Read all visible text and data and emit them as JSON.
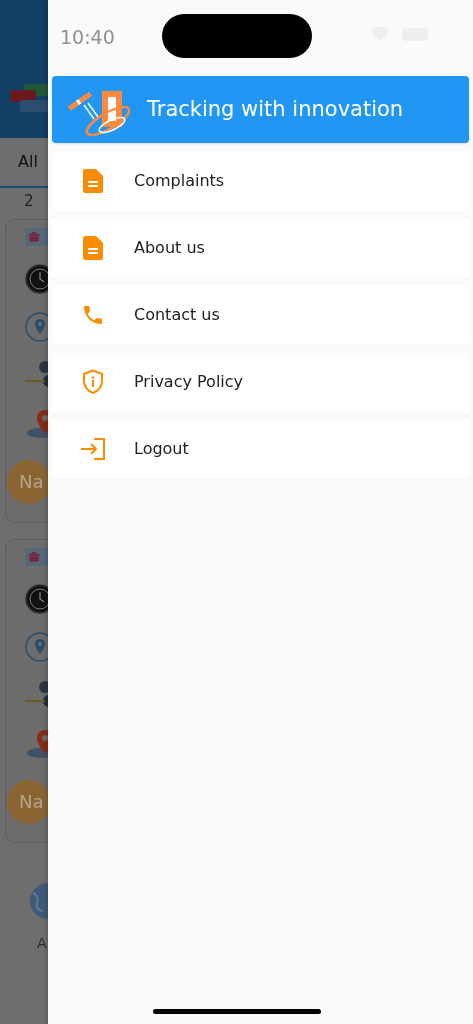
{
  "status_bar": {
    "time": "10:40"
  },
  "background": {
    "tab": "All",
    "count": "2",
    "cards": [
      {
        "avatar": "Na"
      },
      {
        "avatar": "Na"
      }
    ],
    "bottom_nav_label": "A"
  },
  "drawer": {
    "header": {
      "title": "Tracking with innovation"
    },
    "items": [
      {
        "label": "Complaints",
        "kind": "document"
      },
      {
        "label": "About us",
        "kind": "document"
      },
      {
        "label": "Contact us",
        "kind": "phone"
      },
      {
        "label": "Privacy Policy",
        "kind": "shield"
      },
      {
        "label": "Logout",
        "kind": "logout"
      }
    ]
  }
}
